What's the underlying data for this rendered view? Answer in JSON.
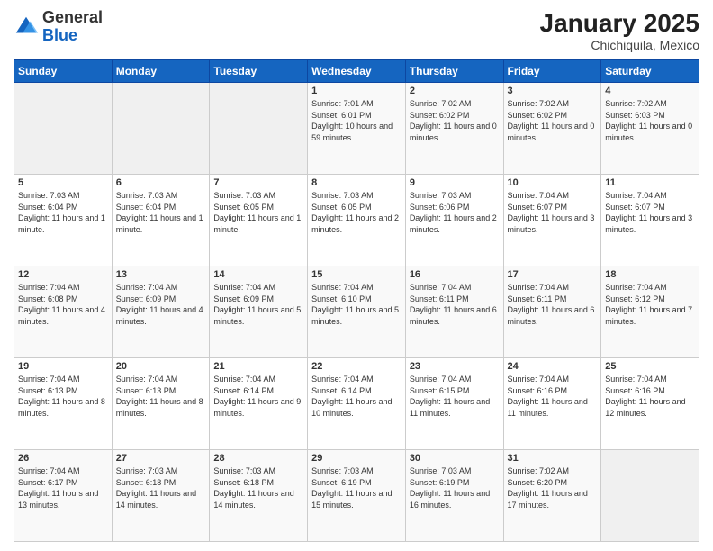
{
  "header": {
    "logo_general": "General",
    "logo_blue": "Blue",
    "title": "January 2025",
    "subtitle": "Chichiquila, Mexico"
  },
  "weekdays": [
    "Sunday",
    "Monday",
    "Tuesday",
    "Wednesday",
    "Thursday",
    "Friday",
    "Saturday"
  ],
  "weeks": [
    [
      {
        "day": "",
        "sunrise": "",
        "sunset": "",
        "daylight": "",
        "empty": true
      },
      {
        "day": "",
        "sunrise": "",
        "sunset": "",
        "daylight": "",
        "empty": true
      },
      {
        "day": "",
        "sunrise": "",
        "sunset": "",
        "daylight": "",
        "empty": true
      },
      {
        "day": "1",
        "sunrise": "Sunrise: 7:01 AM",
        "sunset": "Sunset: 6:01 PM",
        "daylight": "Daylight: 10 hours and 59 minutes."
      },
      {
        "day": "2",
        "sunrise": "Sunrise: 7:02 AM",
        "sunset": "Sunset: 6:02 PM",
        "daylight": "Daylight: 11 hours and 0 minutes."
      },
      {
        "day": "3",
        "sunrise": "Sunrise: 7:02 AM",
        "sunset": "Sunset: 6:02 PM",
        "daylight": "Daylight: 11 hours and 0 minutes."
      },
      {
        "day": "4",
        "sunrise": "Sunrise: 7:02 AM",
        "sunset": "Sunset: 6:03 PM",
        "daylight": "Daylight: 11 hours and 0 minutes."
      }
    ],
    [
      {
        "day": "5",
        "sunrise": "Sunrise: 7:03 AM",
        "sunset": "Sunset: 6:04 PM",
        "daylight": "Daylight: 11 hours and 1 minute."
      },
      {
        "day": "6",
        "sunrise": "Sunrise: 7:03 AM",
        "sunset": "Sunset: 6:04 PM",
        "daylight": "Daylight: 11 hours and 1 minute."
      },
      {
        "day": "7",
        "sunrise": "Sunrise: 7:03 AM",
        "sunset": "Sunset: 6:05 PM",
        "daylight": "Daylight: 11 hours and 1 minute."
      },
      {
        "day": "8",
        "sunrise": "Sunrise: 7:03 AM",
        "sunset": "Sunset: 6:05 PM",
        "daylight": "Daylight: 11 hours and 2 minutes."
      },
      {
        "day": "9",
        "sunrise": "Sunrise: 7:03 AM",
        "sunset": "Sunset: 6:06 PM",
        "daylight": "Daylight: 11 hours and 2 minutes."
      },
      {
        "day": "10",
        "sunrise": "Sunrise: 7:04 AM",
        "sunset": "Sunset: 6:07 PM",
        "daylight": "Daylight: 11 hours and 3 minutes."
      },
      {
        "day": "11",
        "sunrise": "Sunrise: 7:04 AM",
        "sunset": "Sunset: 6:07 PM",
        "daylight": "Daylight: 11 hours and 3 minutes."
      }
    ],
    [
      {
        "day": "12",
        "sunrise": "Sunrise: 7:04 AM",
        "sunset": "Sunset: 6:08 PM",
        "daylight": "Daylight: 11 hours and 4 minutes."
      },
      {
        "day": "13",
        "sunrise": "Sunrise: 7:04 AM",
        "sunset": "Sunset: 6:09 PM",
        "daylight": "Daylight: 11 hours and 4 minutes."
      },
      {
        "day": "14",
        "sunrise": "Sunrise: 7:04 AM",
        "sunset": "Sunset: 6:09 PM",
        "daylight": "Daylight: 11 hours and 5 minutes."
      },
      {
        "day": "15",
        "sunrise": "Sunrise: 7:04 AM",
        "sunset": "Sunset: 6:10 PM",
        "daylight": "Daylight: 11 hours and 5 minutes."
      },
      {
        "day": "16",
        "sunrise": "Sunrise: 7:04 AM",
        "sunset": "Sunset: 6:11 PM",
        "daylight": "Daylight: 11 hours and 6 minutes."
      },
      {
        "day": "17",
        "sunrise": "Sunrise: 7:04 AM",
        "sunset": "Sunset: 6:11 PM",
        "daylight": "Daylight: 11 hours and 6 minutes."
      },
      {
        "day": "18",
        "sunrise": "Sunrise: 7:04 AM",
        "sunset": "Sunset: 6:12 PM",
        "daylight": "Daylight: 11 hours and 7 minutes."
      }
    ],
    [
      {
        "day": "19",
        "sunrise": "Sunrise: 7:04 AM",
        "sunset": "Sunset: 6:13 PM",
        "daylight": "Daylight: 11 hours and 8 minutes."
      },
      {
        "day": "20",
        "sunrise": "Sunrise: 7:04 AM",
        "sunset": "Sunset: 6:13 PM",
        "daylight": "Daylight: 11 hours and 8 minutes."
      },
      {
        "day": "21",
        "sunrise": "Sunrise: 7:04 AM",
        "sunset": "Sunset: 6:14 PM",
        "daylight": "Daylight: 11 hours and 9 minutes."
      },
      {
        "day": "22",
        "sunrise": "Sunrise: 7:04 AM",
        "sunset": "Sunset: 6:14 PM",
        "daylight": "Daylight: 11 hours and 10 minutes."
      },
      {
        "day": "23",
        "sunrise": "Sunrise: 7:04 AM",
        "sunset": "Sunset: 6:15 PM",
        "daylight": "Daylight: 11 hours and 11 minutes."
      },
      {
        "day": "24",
        "sunrise": "Sunrise: 7:04 AM",
        "sunset": "Sunset: 6:16 PM",
        "daylight": "Daylight: 11 hours and 11 minutes."
      },
      {
        "day": "25",
        "sunrise": "Sunrise: 7:04 AM",
        "sunset": "Sunset: 6:16 PM",
        "daylight": "Daylight: 11 hours and 12 minutes."
      }
    ],
    [
      {
        "day": "26",
        "sunrise": "Sunrise: 7:04 AM",
        "sunset": "Sunset: 6:17 PM",
        "daylight": "Daylight: 11 hours and 13 minutes."
      },
      {
        "day": "27",
        "sunrise": "Sunrise: 7:03 AM",
        "sunset": "Sunset: 6:18 PM",
        "daylight": "Daylight: 11 hours and 14 minutes."
      },
      {
        "day": "28",
        "sunrise": "Sunrise: 7:03 AM",
        "sunset": "Sunset: 6:18 PM",
        "daylight": "Daylight: 11 hours and 14 minutes."
      },
      {
        "day": "29",
        "sunrise": "Sunrise: 7:03 AM",
        "sunset": "Sunset: 6:19 PM",
        "daylight": "Daylight: 11 hours and 15 minutes."
      },
      {
        "day": "30",
        "sunrise": "Sunrise: 7:03 AM",
        "sunset": "Sunset: 6:19 PM",
        "daylight": "Daylight: 11 hours and 16 minutes."
      },
      {
        "day": "31",
        "sunrise": "Sunrise: 7:02 AM",
        "sunset": "Sunset: 6:20 PM",
        "daylight": "Daylight: 11 hours and 17 minutes."
      },
      {
        "day": "",
        "sunrise": "",
        "sunset": "",
        "daylight": "",
        "empty": true
      }
    ]
  ]
}
